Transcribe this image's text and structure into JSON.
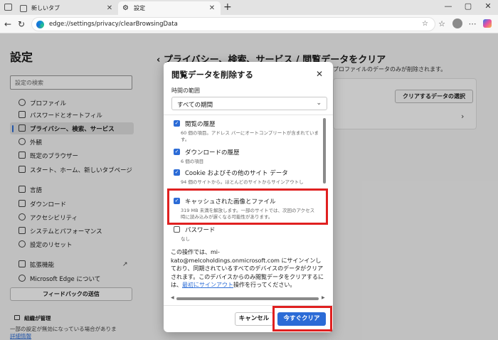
{
  "browser": {
    "tabs": [
      {
        "label": "新しいタブ",
        "active": false
      },
      {
        "label": "設定",
        "active": true
      }
    ],
    "url": "edge://settings/privacy/clearBrowsingData",
    "window_controls": {
      "minimize": "—",
      "maximize": "▢",
      "close": "✕"
    }
  },
  "settings": {
    "title": "設定",
    "search_placeholder": "設定の検索",
    "nav": [
      {
        "label": "プロファイル",
        "icon": "profile-icon"
      },
      {
        "label": "パスワードとオートフィル",
        "icon": "key-icon"
      },
      {
        "label": "プライバシー、検索、サービス",
        "icon": "lock-icon",
        "selected": true
      },
      {
        "label": "外観",
        "icon": "appearance-icon"
      },
      {
        "label": "既定のブラウザー",
        "icon": "browser-icon"
      },
      {
        "label": "スタート、ホーム、新しいタブページ",
        "icon": "home-icon"
      },
      {
        "label": "言語",
        "icon": "language-icon"
      },
      {
        "label": "ダウンロード",
        "icon": "download-icon"
      },
      {
        "label": "アクセシビリティ",
        "icon": "accessibility-icon"
      },
      {
        "label": "システムとパフォーマンス",
        "icon": "system-icon"
      },
      {
        "label": "設定のリセット",
        "icon": "reset-icon"
      },
      {
        "label": "拡張機能",
        "icon": "extensions-icon"
      },
      {
        "label": "Microsoft Edge について",
        "icon": "edge-icon"
      }
    ],
    "feedback_label": "フィードバックの送信",
    "org_title": "組織が管理",
    "org_text": "一部の設定が無効になっている場合がありま",
    "org_link": "詳細情報",
    "main_heading": "‹ プライバシー、検索、サービス / 閲覧データをクリア",
    "main_sub": "プロファイルのデータのみが削除されます。",
    "choose_button": "クリアするデータの選択"
  },
  "dialog": {
    "title": "閲覧データを削除する",
    "range_label": "時間の範囲",
    "range_value": "すべての期間",
    "items": [
      {
        "title": "閲覧の履歴",
        "desc": "60 個の項目。アドレス バーにオートコンプリートが含まれています。",
        "checked": true
      },
      {
        "title": "ダウンロードの履歴",
        "desc": "6 個の項目",
        "checked": true
      },
      {
        "title": "Cookie およびその他のサイト データ",
        "desc": "94 個のサイトから。ほとんどのサイトからサインアウトし",
        "checked": true
      },
      {
        "title": "キャッシュされた画像とファイル",
        "desc": "319 MB 未満を解放します。一部のサイトでは、次回のアクセス時に読み込みが遅くなる可能性があります。",
        "checked": true
      },
      {
        "title": "パスワード",
        "desc": "なし",
        "checked": false
      }
    ],
    "info_text": "この操作では、mi-kato@melcoholdings.onmicrosoft.com にサインインしており、同期されているすべてのデバイスのデータがクリアされます。このデバイスからのみ閲覧データをクリアするには、",
    "info_link": "最初にサインアウト",
    "info_text_after": "操作を行ってください。",
    "cancel_label": "キャンセル",
    "clear_label": "今すぐクリア"
  },
  "colors": {
    "accent": "#2b6bd6",
    "highlight": "#e02020"
  }
}
